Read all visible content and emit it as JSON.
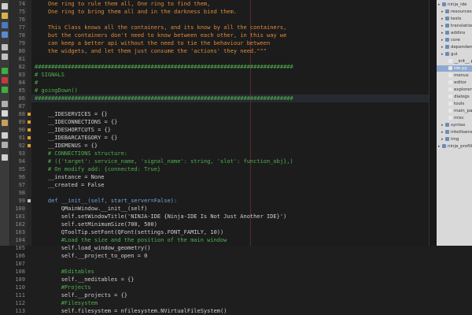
{
  "editor": {
    "lines": [
      {
        "n": "74",
        "t": "    One ring to rule them all, One ring to find them,",
        "c": "#e08a3a"
      },
      {
        "n": "75",
        "t": "    One ring to bring them all and in the darkness bind them.",
        "c": "#e08a3a"
      },
      {
        "n": "76",
        "t": "",
        "c": "#cccccc"
      },
      {
        "n": "77",
        "t": "    This Class knows all the containers, and its know by all the containers,",
        "c": "#e08a3a"
      },
      {
        "n": "78",
        "t": "    but the containers don't need to know between each other, in this way we",
        "c": "#e08a3a"
      },
      {
        "n": "79",
        "t": "    can keep a better api without the need to tie the behaviour between",
        "c": "#e08a3a"
      },
      {
        "n": "80",
        "t": "    the widgets, and let them just consume the 'actions' they need.\"\"\"",
        "c": "#e08a3a"
      },
      {
        "n": "81",
        "t": "",
        "c": "#cccccc"
      },
      {
        "n": "82",
        "t": "##############################################################################",
        "c": "#4fb04f"
      },
      {
        "n": "83",
        "t": "# SIGNALS",
        "c": "#4fb04f"
      },
      {
        "n": "84",
        "t": "#",
        "c": "#4fb04f"
      },
      {
        "n": "85",
        "t": "# goingDown()",
        "c": "#4fb04f"
      },
      {
        "n": "86",
        "t": "##############################################################################",
        "c": "#4fb04f"
      },
      {
        "n": "87",
        "t": "",
        "c": "#cccccc"
      },
      {
        "n": "88",
        "t": "    __IDESERVICES = {}",
        "c": "#d0d0d0"
      },
      {
        "n": "89",
        "t": "    __IDECONNECTIONS = {}",
        "c": "#d0d0d0"
      },
      {
        "n": "90",
        "t": "    __IDESHORTCUTS = {}",
        "c": "#d0d0d0"
      },
      {
        "n": "91",
        "t": "    __IDEBARCATEGORY = {}",
        "c": "#d0d0d0"
      },
      {
        "n": "92",
        "t": "    __IDEMENUS = {}",
        "c": "#d0d0d0"
      },
      {
        "n": "93",
        "t": "    # CONNECTIONS structure:",
        "c": "#4fb04f"
      },
      {
        "n": "94",
        "t": "    # ({'target': service_name, 'signal_name': string, 'slot': function_obj},)",
        "c": "#4fb04f"
      },
      {
        "n": "95",
        "t": "    # On modify add: {connected: True}",
        "c": "#4fb04f"
      },
      {
        "n": "96",
        "t": "    __instance = None",
        "c": "#d0d0d0"
      },
      {
        "n": "97",
        "t": "    __created = False",
        "c": "#d0d0d0"
      },
      {
        "n": "98",
        "t": "",
        "c": "#cccccc"
      },
      {
        "n": "99",
        "t": "    def __init__(self, start_server=False):",
        "c": "#6fa8dc"
      },
      {
        "n": "100",
        "t": "        QMainWindow.__init__(self)",
        "c": "#d0d0d0"
      },
      {
        "n": "101",
        "t": "        self.setWindowTitle('NINJA-IDE {Ninja-IDE Is Not Just Another IDE}')",
        "c": "#d0d0d0"
      },
      {
        "n": "102",
        "t": "        self.setMinimumSize(700, 500)",
        "c": "#d0d0d0"
      },
      {
        "n": "103",
        "t": "        QToolTip.setFont(QFont(settings.FONT_FAMILY, 10))",
        "c": "#d0d0d0"
      },
      {
        "n": "104",
        "t": "        #Load the size and the position of the main window",
        "c": "#4fb04f"
      },
      {
        "n": "105",
        "t": "        self.load_window_geometry()",
        "c": "#d0d0d0"
      },
      {
        "n": "106",
        "t": "        self.__project_to_open = 0",
        "c": "#d0d0d0"
      },
      {
        "n": "107",
        "t": "",
        "c": "#cccccc"
      },
      {
        "n": "108",
        "t": "        #Editables",
        "c": "#4fb04f"
      },
      {
        "n": "109",
        "t": "        self.__neditables = {}",
        "c": "#d0d0d0"
      },
      {
        "n": "110",
        "t": "        #Projects",
        "c": "#4fb04f"
      },
      {
        "n": "111",
        "t": "        self.__projects = {}",
        "c": "#d0d0d0"
      },
      {
        "n": "112",
        "t": "        #Filesystem",
        "c": "#4fb04f"
      },
      {
        "n": "113",
        "t": "        self.filesystem = nfilesystem.NVirtualFileSystem()",
        "c": "#d0d0d0"
      }
    ]
  },
  "tree": {
    "items": [
      {
        "label": "ninja_ide",
        "depth": 0,
        "sel": false
      },
      {
        "label": "resources",
        "depth": 1,
        "sel": false
      },
      {
        "label": "tests",
        "depth": 1,
        "sel": false
      },
      {
        "label": "translations",
        "depth": 1,
        "sel": false
      },
      {
        "label": "addins",
        "depth": 1,
        "sel": false
      },
      {
        "label": "core",
        "depth": 1,
        "sel": false
      },
      {
        "label": "dependencies",
        "depth": 1,
        "sel": false
      },
      {
        "label": "gui",
        "depth": 1,
        "sel": false
      },
      {
        "label": "__init__.py",
        "depth": 2,
        "sel": false
      },
      {
        "label": "ide.py",
        "depth": 2,
        "sel": true
      },
      {
        "label": "menus",
        "depth": 2,
        "sel": false
      },
      {
        "label": "editor",
        "depth": 2,
        "sel": false
      },
      {
        "label": "explorer",
        "depth": 2,
        "sel": false
      },
      {
        "label": "dialogs",
        "depth": 2,
        "sel": false
      },
      {
        "label": "tools",
        "depth": 2,
        "sel": false
      },
      {
        "label": "main_panel",
        "depth": 2,
        "sel": false
      },
      {
        "label": "misc",
        "depth": 2,
        "sel": false
      },
      {
        "label": "syntax",
        "depth": 1,
        "sel": false
      },
      {
        "label": "intellisense",
        "depth": 1,
        "sel": false
      },
      {
        "label": "img",
        "depth": 1,
        "sel": false
      },
      {
        "label": "ninja_profiling",
        "depth": 0,
        "sel": false
      }
    ]
  },
  "colors": {
    "accent": "#8fa9cf",
    "comment": "#4fb04f",
    "string": "#e08a3a",
    "keyword": "#6fa8dc"
  }
}
